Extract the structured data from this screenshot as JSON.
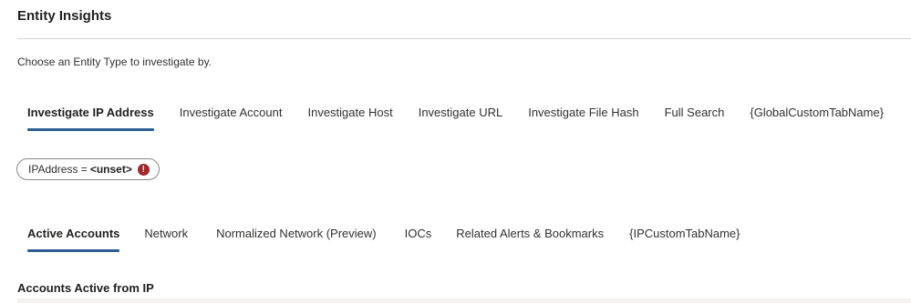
{
  "page": {
    "title": "Entity Insights",
    "instruction": "Choose an Entity Type to investigate by."
  },
  "entity_tabs": [
    {
      "label": "Investigate IP Address",
      "active": true
    },
    {
      "label": "Investigate Account",
      "active": false
    },
    {
      "label": "Investigate Host",
      "active": false
    },
    {
      "label": "Investigate URL",
      "active": false
    },
    {
      "label": "Investigate File Hash",
      "active": false
    },
    {
      "label": "Full Search",
      "active": false
    },
    {
      "label": "{GlobalCustomTabName}",
      "active": false
    }
  ],
  "parameter": {
    "name": "IPAddress = ",
    "value": "<unset>",
    "status_icon": "error-icon"
  },
  "ip_tabs": [
    {
      "label": "Active Accounts",
      "active": true
    },
    {
      "label": "Network",
      "active": false
    },
    {
      "label": "Normalized Network (Preview)",
      "active": false
    },
    {
      "label": "IOCs",
      "active": false
    },
    {
      "label": "Related Alerts & Bookmarks",
      "active": false
    },
    {
      "label": "{IPCustomTabName}",
      "active": false
    }
  ],
  "section": {
    "title": "Accounts Active from IP"
  },
  "colors": {
    "accent": "#2f5e93",
    "error": "#a4262c"
  }
}
